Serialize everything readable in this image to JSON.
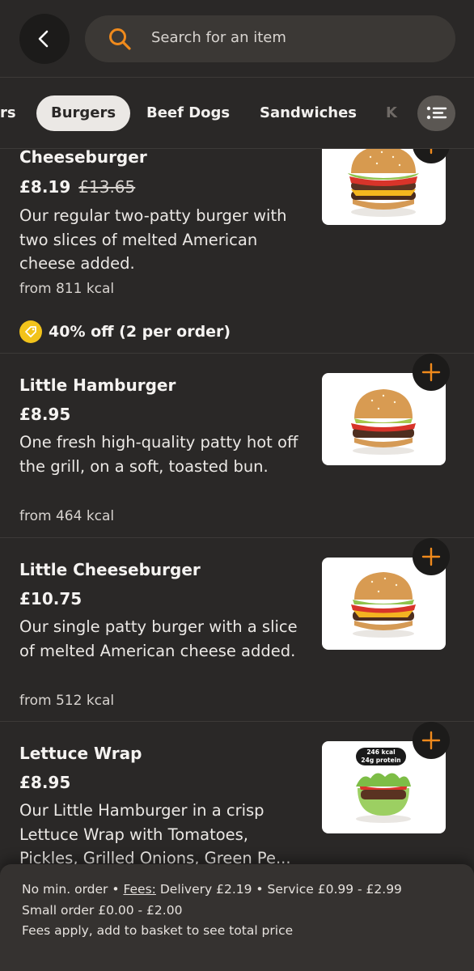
{
  "header": {
    "back_icon": "chevron-left-icon",
    "search_icon": "search-icon",
    "search_placeholder": "Search for an item"
  },
  "tabs": [
    {
      "label": "rs",
      "active": false
    },
    {
      "label": "Burgers",
      "active": true
    },
    {
      "label": "Beef Dogs",
      "active": false
    },
    {
      "label": "Sandwiches",
      "active": false
    },
    {
      "label": "K",
      "active": false
    }
  ],
  "filter_icon": "list-filter-icon",
  "items": [
    {
      "name": "Cheeseburger",
      "price": "£8.19",
      "old_price": "£13.65",
      "desc": "Our regular two-patty burger with two slices of melted American cheese added.",
      "kcal": "from 811 kcal",
      "promo": "40% off (2 per order)"
    },
    {
      "name": "Little Hamburger",
      "price": "£8.95",
      "desc": "One fresh high-quality patty hot off the grill, on a soft, toasted bun.",
      "kcal": "from 464 kcal"
    },
    {
      "name": "Little Cheeseburger",
      "price": "£10.75",
      "desc": "Our single patty burger with a slice of melted American cheese added.",
      "kcal": "from 512 kcal"
    },
    {
      "name": "Lettuce Wrap",
      "price": "£8.95",
      "desc": "Our Little Hamburger in a crisp Lettuce Wrap with Tomatoes, Pickles, Grilled Onions, Green Pe...",
      "badge_kcal": "246 kcal",
      "badge_protein": "24g protein"
    }
  ],
  "footer": {
    "min_order": "No min. order",
    "sep": "•",
    "fees_link": "Fees:",
    "delivery": "Delivery £2.19",
    "service": "Service £0.99 - £2.99",
    "small_order": "Small order £0.00 - £2.00",
    "note": "Fees apply, add to basket to see total price"
  },
  "colors": {
    "background": "#2a2827",
    "accent": "#f08a1c",
    "promo_tag": "#f2c31b"
  }
}
